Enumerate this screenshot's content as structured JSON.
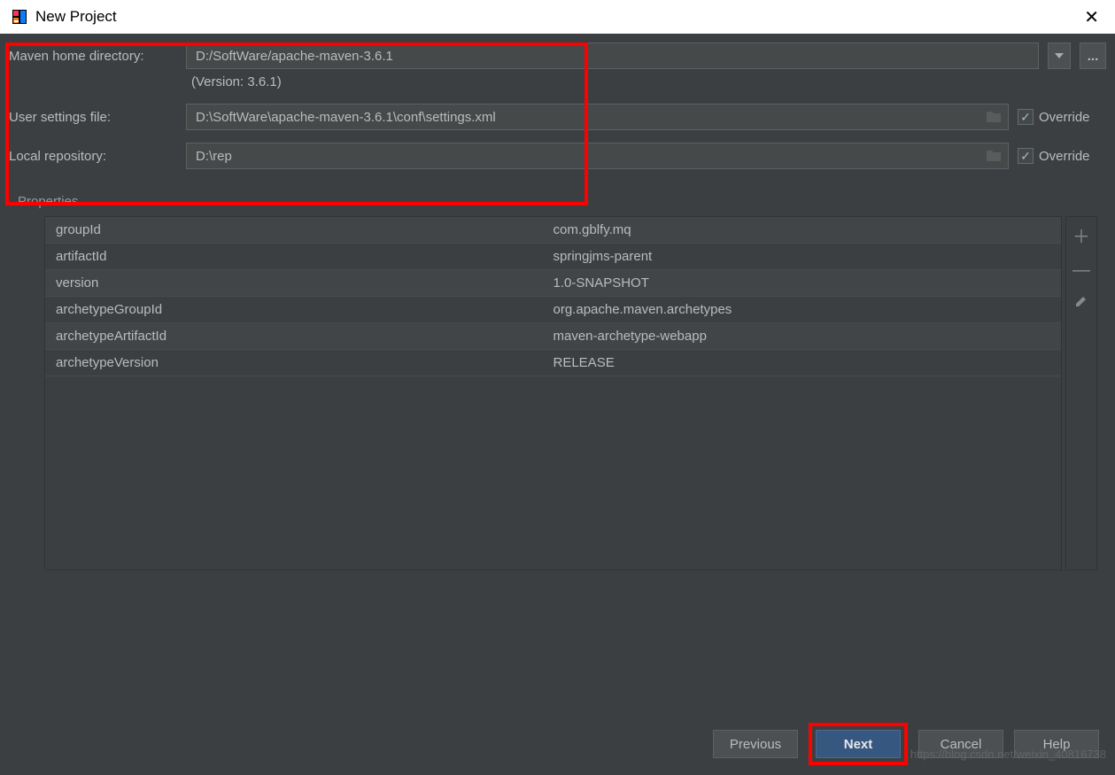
{
  "window": {
    "title": "New Project"
  },
  "form": {
    "maven_home_label": "Maven home directory:",
    "maven_home_value": "D:/SoftWare/apache-maven-3.6.1",
    "version_text": "(Version: 3.6.1)",
    "user_settings_label": "User settings file:",
    "user_settings_value": "D:\\SoftWare\\apache-maven-3.6.1\\conf\\settings.xml",
    "local_repo_label": "Local repository:",
    "local_repo_value": "D:\\rep",
    "override_label": "Override",
    "ellipsis": "..."
  },
  "properties": {
    "section_label": "Properties",
    "rows": [
      {
        "key": "groupId",
        "val": "com.gblfy.mq"
      },
      {
        "key": "artifactId",
        "val": "springjms-parent"
      },
      {
        "key": "version",
        "val": "1.0-SNAPSHOT"
      },
      {
        "key": "archetypeGroupId",
        "val": "org.apache.maven.archetypes"
      },
      {
        "key": "archetypeArtifactId",
        "val": "maven-archetype-webapp"
      },
      {
        "key": "archetypeVersion",
        "val": "RELEASE"
      }
    ]
  },
  "buttons": {
    "previous": "Previous",
    "next": "Next",
    "cancel": "Cancel",
    "help": "Help"
  },
  "watermark": "https://blog.csdn.net/weixin_40816738"
}
